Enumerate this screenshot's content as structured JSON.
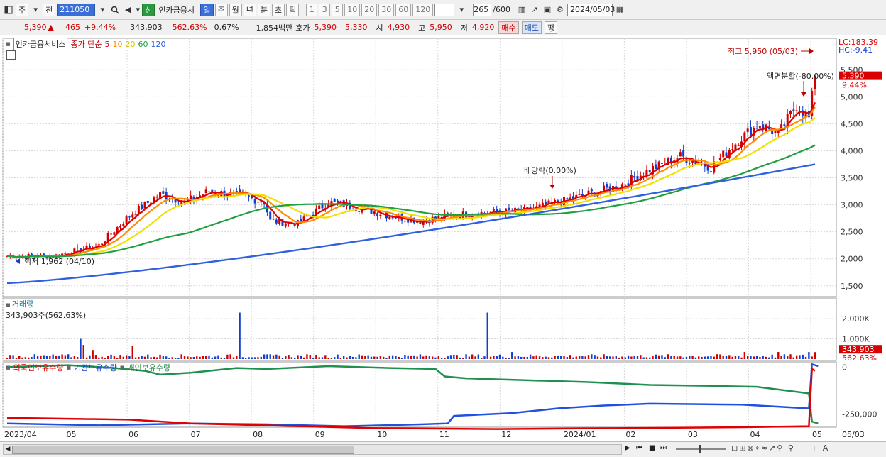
{
  "toolbar": {
    "period_unit": "주",
    "prev_label": "전",
    "code": "211050",
    "new_badge": "신",
    "stock_name": "인카금융서",
    "tabs": [
      "일",
      "주",
      "월",
      "년",
      "분",
      "초",
      "틱"
    ],
    "active_tab": "일",
    "intervals": [
      "1",
      "3",
      "5",
      "10",
      "20",
      "30",
      "60",
      "120"
    ],
    "count": "265",
    "count_total": "/600",
    "date": "2024/05/03"
  },
  "quote": {
    "price": "5,390",
    "arrow": "▲",
    "change": "465",
    "change_pct": "+9.44%",
    "volume": "343,903",
    "volume_pct": "562.63%",
    "turnover": "0.67%",
    "amount": "1,854백만",
    "ask_label": "호가",
    "ask1": "5,390",
    "ask2": "5,330",
    "open_label": "시",
    "open": "4,930",
    "high_label": "고",
    "high": "5,950",
    "low_label": "저",
    "low": "4,920",
    "buy_label": "매수",
    "sell_label": "매도",
    "eval_label": "평"
  },
  "price_panel": {
    "name_box": "인카금융서비스",
    "ma_title": "종가 단순",
    "ma_periods": [
      "5",
      "10",
      "20",
      "60",
      "120"
    ],
    "lc_label": "LC:183.39",
    "hc_label": "HC:-9.41",
    "current_price_tag": "5,390",
    "current_pct_tag": "9.44%",
    "high_annotation": "최고 5,950 (05/03)",
    "low_annotation": "최저 1,962 (04/10)",
    "split_annotation": "액면분할(-80.00%)",
    "dividend_annotation": "배당락(0.00%)",
    "y_ticks": [
      "5,500",
      "5,000",
      "4,500",
      "4,000",
      "3,500",
      "3,000",
      "2,500",
      "2,000",
      "1,500"
    ]
  },
  "volume_panel": {
    "title": "거래량",
    "value": "343,903주(562.63%)",
    "y_ticks": [
      "2,000K",
      "1,000K"
    ],
    "tag_value": "343,903",
    "tag_pct": "562.63%"
  },
  "holding_panel": {
    "series": [
      "외국인보유수량",
      "기관보유수량",
      "개인보유수량"
    ],
    "y_ticks": [
      "0",
      "-250,000"
    ]
  },
  "x_axis": {
    "labels": [
      "2023/04",
      "05",
      "06",
      "07",
      "08",
      "09",
      "10",
      "11",
      "12",
      "2024/01",
      "02",
      "03",
      "04",
      "05"
    ],
    "right_label": "05/03"
  },
  "colors": {
    "ma5": "#e00000",
    "ma10": "#ff8c00",
    "ma20": "#f0e000",
    "ma60": "#20a040",
    "ma120": "#3060e0",
    "up": "#d00000",
    "down": "#1040d0"
  }
}
